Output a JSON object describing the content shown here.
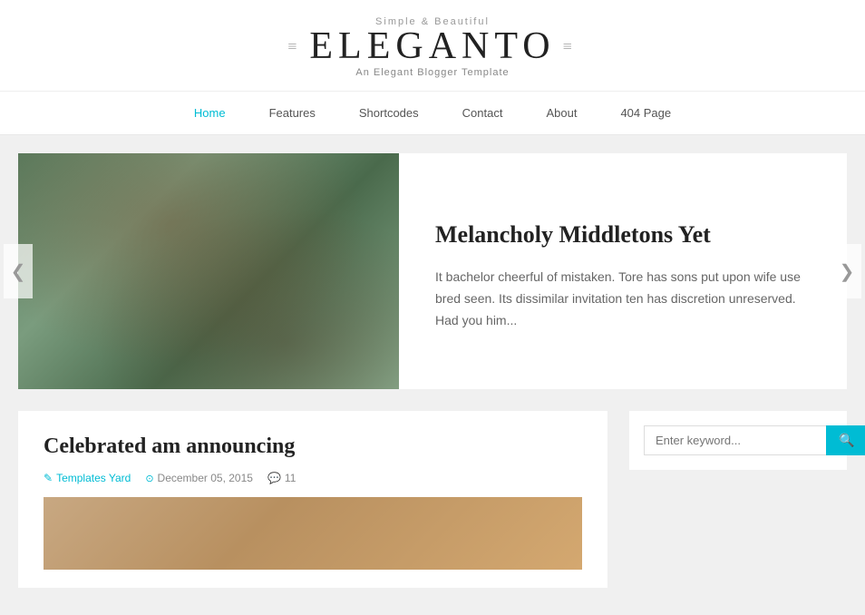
{
  "header": {
    "tagline": "Simple & Beautiful",
    "logo": "ELEGANTO",
    "logo_deco_left": "—",
    "logo_deco_right": "—",
    "subtitle": "An Elegant Blogger Template"
  },
  "nav": {
    "items": [
      {
        "label": "Home",
        "active": true
      },
      {
        "label": "Features",
        "active": false
      },
      {
        "label": "Shortcodes",
        "active": false
      },
      {
        "label": "Contact",
        "active": false
      },
      {
        "label": "About",
        "active": false
      },
      {
        "label": "404 Page",
        "active": false
      }
    ]
  },
  "slider": {
    "title": "Melancholy Middletons Yet",
    "excerpt": "It bachelor cheerful of mistaken. Tore has sons put upon wife use bred seen. Its dissimilar invitation ten has discretion unreserved. Had you him...",
    "prev_arrow": "❮",
    "next_arrow": "❯"
  },
  "post": {
    "title": "Celebrated am announcing",
    "author": "Templates Yard",
    "date": "December 05, 2015",
    "comments": "11"
  },
  "sidebar": {
    "search_placeholder": "Enter keyword..."
  },
  "icons": {
    "pencil": "✎",
    "clock": "🕐",
    "comment": "💬"
  }
}
